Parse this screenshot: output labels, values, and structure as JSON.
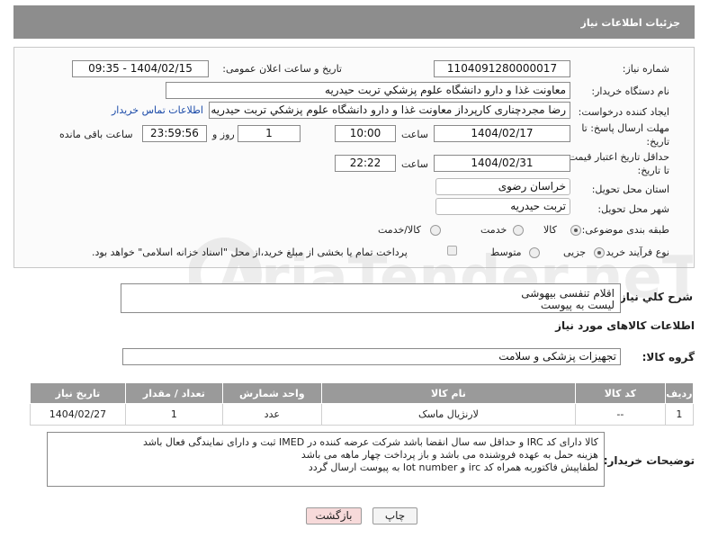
{
  "header": {
    "title": "جزئیات اطلاعات نیاز"
  },
  "labels": {
    "need_number": "شماره نیاز:",
    "announce_datetime": "تاریخ و ساعت اعلان عمومی:",
    "buyer_org": "نام دستگاه خریدار:",
    "requester": "ایجاد کننده درخواست:",
    "deadline": "مهلت ارسال پاسخ: تا تاریخ:",
    "deadline_line1": "مهلت ارسال پاسخ: تا",
    "deadline_line2": "تاریخ:",
    "validity_line1": "حداقل تاریخ اعتبار قیمت:",
    "validity_line2": "تا تاریخ:",
    "province": "استان محل تحویل:",
    "city": "شهر محل تحویل:",
    "category": "طبقه بندی موضوعی:",
    "process_type": "نوع فرآیند خرید :",
    "time": "ساعت",
    "time2": "ساعت",
    "day_and": "روز و",
    "remaining": "ساعت باقی مانده",
    "description": "شرح کلي نياز:",
    "goods_info": "اطلاعات کالاهای مورد نیاز",
    "goods_group": "گروه کالا:",
    "buyer_notes": "توضیحات خریدار:"
  },
  "values": {
    "need_number": "1104091280000017",
    "announce_datetime": "1404/02/15 - 09:35",
    "buyer_org": "معاونت غذا و دارو   دانشگاه علوم پزشکي تربت حيدريه",
    "requester": "رضا مجردچناری کارپرداز معاونت غذا و دارو   دانشگاه علوم پزشکي تربت حيدريه",
    "contact_link": "اطلاعات تماس خریدار",
    "deadline_date": "1404/02/17",
    "deadline_time": "10:00",
    "days": "1",
    "remaining_time": "23:59:56",
    "validity_date": "1404/02/31",
    "validity_time": "22:22",
    "province": "خراسان رضوی",
    "city": "تربت حيدريه",
    "description_line1": "اقلام تنفسی بیهوشی",
    "description_line2": "لیست به پیوست",
    "goods_group": "تجهیزات پزشکی و سلامت"
  },
  "category_options": [
    {
      "label": "کالا",
      "selected": true
    },
    {
      "label": "خدمت",
      "selected": false
    },
    {
      "label": "کالا/خدمت",
      "selected": false
    }
  ],
  "process_options": [
    {
      "label": "جزیی",
      "selected": true
    },
    {
      "label": "متوسط",
      "selected": false
    }
  ],
  "payment_note": "پرداخت تمام یا بخشی از مبلغ خرید،از محل \"اسناد خزانه اسلامی\" خواهد بود.",
  "table": {
    "headers": [
      "ردیف",
      "کد کالا",
      "نام کالا",
      "واحد شمارش",
      "تعداد / مقدار",
      "تاریخ نیاز"
    ],
    "rows": [
      [
        "1",
        "--",
        "لارنژیال ماسک",
        "عدد",
        "1",
        "1404/02/27"
      ]
    ]
  },
  "buyer_notes": {
    "line1": "کالا دارای کد IRC و حداقل سه سال انقضا باشد شرکت عرضه کننده در IMED ثبت و دارای نمایندگی فعال باشد",
    "line2": "هزینه حمل به عهده فروشنده می باشد و باز پرداخت چهار ماهه می باشد",
    "line3": "لطفاپیش فاکتوربه همراه کد irc و lot number به پیوست ارسال گردد"
  },
  "buttons": {
    "print": "چاپ",
    "back": "بازگشت"
  },
  "watermark_text": "AriaTender.neT",
  "colors": {
    "header_bg": "#8d8d8d",
    "table_header_bg": "#9a9a9a",
    "link": "#1a4aa8",
    "back_button_bg": "#f7dada"
  }
}
